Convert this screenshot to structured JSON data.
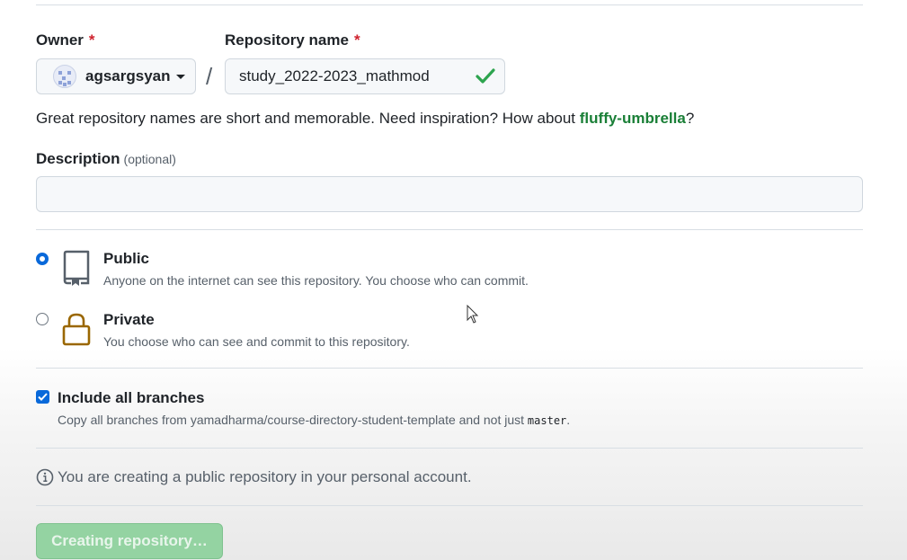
{
  "owner": {
    "label": "Owner",
    "required_mark": "*",
    "name": "agsargsyan"
  },
  "separator": "/",
  "repository": {
    "label": "Repository name",
    "required_mark": "*",
    "value": "study_2022-2023_mathmod",
    "valid": true
  },
  "hint": {
    "prefix": "Great repository names are short and memorable. Need inspiration? How about ",
    "suggestion": "fluffy-umbrella",
    "suffix": "?"
  },
  "description": {
    "label": "Description",
    "optional": "(optional)",
    "value": ""
  },
  "visibility": {
    "selected": "public",
    "public": {
      "title": "Public",
      "desc": "Anyone on the internet can see this repository. You choose who can commit."
    },
    "private": {
      "title": "Private",
      "desc": "You choose who can see and commit to this repository."
    }
  },
  "branches": {
    "checked": true,
    "title": "Include all branches",
    "desc_prefix": "Copy all branches from yamadharma/course-directory-student-template and not just ",
    "branch": "master",
    "desc_suffix": "."
  },
  "notice": "You are creating a public repository in your personal account.",
  "submit": {
    "label": "Creating repository…",
    "disabled": true
  },
  "colors": {
    "accent_blue": "#0969da",
    "success_green": "#1a7f37",
    "required_red": "#cf222e",
    "button_disabled_green": "#94d3a2",
    "private_icon": "#9a6700"
  }
}
